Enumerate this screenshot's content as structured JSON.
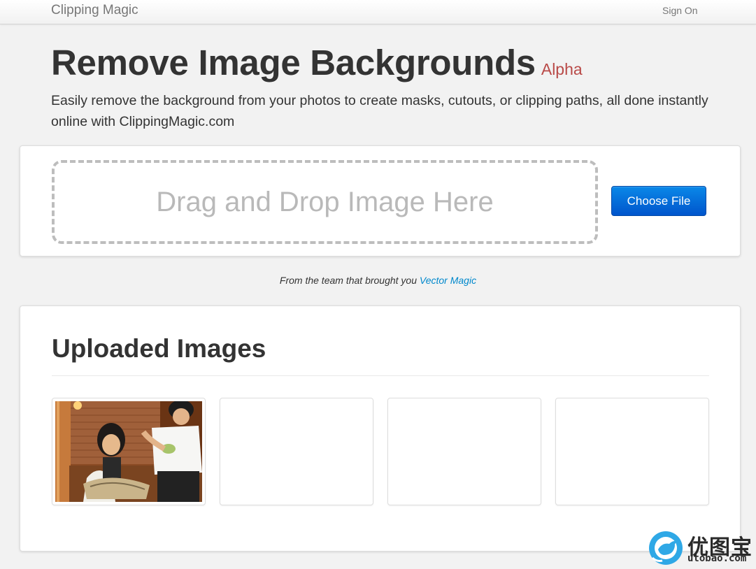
{
  "navbar": {
    "brand": "Clipping Magic",
    "sign_on": "Sign On"
  },
  "hero": {
    "title": "Remove Image Backgrounds",
    "badge": "Alpha",
    "subtitle": "Easily remove the background from your photos to create masks, cutouts, or clipping paths, all done instantly online with ClippingMagic.com"
  },
  "upload": {
    "dropzone_text": "Drag and Drop Image Here",
    "choose_file_label": "Choose File"
  },
  "tagline": {
    "text": "From the team that brought you ",
    "link": "Vector Magic"
  },
  "uploaded": {
    "title": "Uploaded Images",
    "thumbnails": [
      "photo-thumbnail",
      "empty",
      "empty",
      "empty"
    ]
  },
  "watermark": {
    "chinese": "优图宝",
    "url": "utobao.com"
  },
  "colors": {
    "page_bg": "#f2f2f2",
    "badge": "#b94a48",
    "button_blue": "#0062d6",
    "link": "#0088cc",
    "dropzone_border": "#bdbdbd"
  }
}
